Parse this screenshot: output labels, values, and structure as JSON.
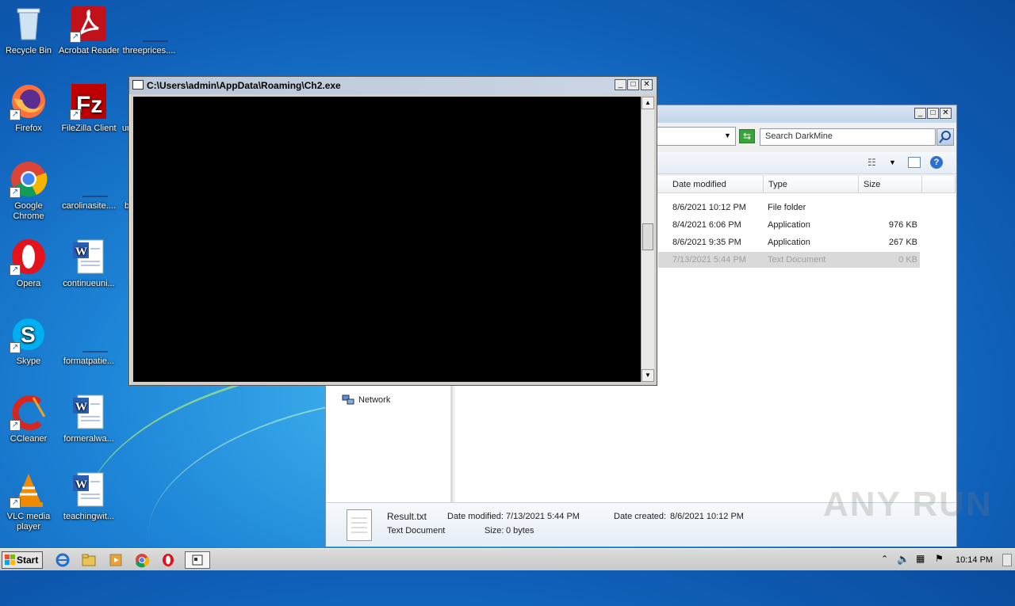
{
  "desktop": {
    "icons": [
      {
        "label": "Recycle Bin",
        "icon": "recycle-bin-icon"
      },
      {
        "label": "Acrobat Reader DC",
        "icon": "acrobat-icon"
      },
      {
        "label": "threeprices....",
        "icon": "file-icon"
      },
      {
        "label": "Firefox",
        "icon": "firefox-icon"
      },
      {
        "label": "FileZilla Client",
        "icon": "filezilla-icon"
      },
      {
        "label": "un",
        "icon": "file-icon"
      },
      {
        "label": "Google Chrome",
        "icon": "chrome-icon"
      },
      {
        "label": "carolinasite....",
        "icon": "file-icon"
      },
      {
        "label": "b",
        "icon": "file-icon"
      },
      {
        "label": "Opera",
        "icon": "opera-icon"
      },
      {
        "label": "continueuni...",
        "icon": "word-doc-icon"
      },
      {
        "label": "Skype",
        "icon": "skype-icon"
      },
      {
        "label": "formatpatie...",
        "icon": "file-icon"
      },
      {
        "label": "CCleaner",
        "icon": "ccleaner-icon"
      },
      {
        "label": "formeralwa...",
        "icon": "word-doc-icon"
      },
      {
        "label": "VLC media player",
        "icon": "vlc-icon"
      },
      {
        "label": "teachingwit...",
        "icon": "word-doc-icon"
      }
    ]
  },
  "console": {
    "title": "C:\\Users\\admin\\AppData\\Roaming\\Ch2.exe"
  },
  "explorer": {
    "search_placeholder": "Search DarkMine",
    "columns": [
      "Date modified",
      "Type",
      "Size"
    ],
    "files": [
      {
        "date": "8/6/2021 10:12 PM",
        "type": "File folder",
        "size": ""
      },
      {
        "date": "8/4/2021 6:06 PM",
        "type": "Application",
        "size": "976 KB"
      },
      {
        "date": "8/6/2021 9:35 PM",
        "type": "Application",
        "size": "267 KB"
      },
      {
        "date": "7/13/2021 5:44 PM",
        "type": "Text Document",
        "size": "0 KB"
      }
    ],
    "nav_network": "Network",
    "details": {
      "name": "Result.txt",
      "type": "Text Document",
      "modified_label": "Date modified:",
      "modified": "7/13/2021 5:44 PM",
      "created_label": "Date created:",
      "created": "8/6/2021 10:12 PM",
      "size_label": "Size:",
      "size": "0 bytes"
    }
  },
  "taskbar": {
    "start_label": "Start",
    "clock": "10:14 PM"
  },
  "watermark": "ANY RUN"
}
